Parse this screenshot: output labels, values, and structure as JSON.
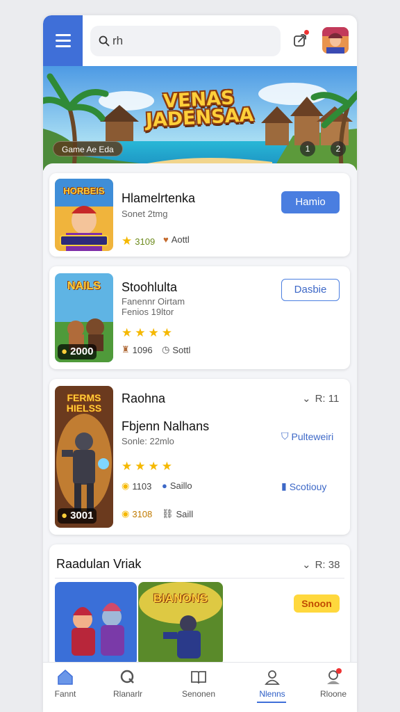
{
  "search": {
    "value": "rh"
  },
  "banner": {
    "title": "VENAS JADENSAA",
    "tag": "Game Ae Eda",
    "ctrl_left": "1",
    "ctrl_right": "2"
  },
  "cards": [
    {
      "title": "Hlamelrtenka",
      "sub": "Sonet 2tmg",
      "rating_text": "3109",
      "stat2": "Aottl",
      "button": "Hamio",
      "thumb_title": "HORBEIS"
    },
    {
      "title": "Stoohlulta",
      "sub1": "Fanennr Oirtam",
      "sub2": "Fenios 19ltor",
      "stat1": "1096",
      "stat2": "Sottl",
      "button": "Dasbie",
      "thumb_title": "NAILS",
      "coin": "2000"
    },
    {
      "title": "Raohna",
      "meta": "R: 11",
      "subtitle": "Fbjenn Nalhans",
      "sub": "Sonle: 22mlo",
      "link1": "Pulteweiri",
      "stat1": "1103",
      "stat2": "Saillo",
      "link2": "Scotiouy",
      "stat3": "3108",
      "stat4": "Saill",
      "thumb_title": "FERMS HIELSS",
      "coin": "3001"
    }
  ],
  "section": {
    "title": "Raadulan Vriak",
    "meta": "R: 38",
    "badge": "Snoon",
    "thumb_title": "BIANONS"
  },
  "nav": [
    {
      "label": "Fannt"
    },
    {
      "label": "Rlanarlr"
    },
    {
      "label": "Senonen"
    },
    {
      "label": "Nlenns"
    },
    {
      "label": "Rloone"
    }
  ]
}
